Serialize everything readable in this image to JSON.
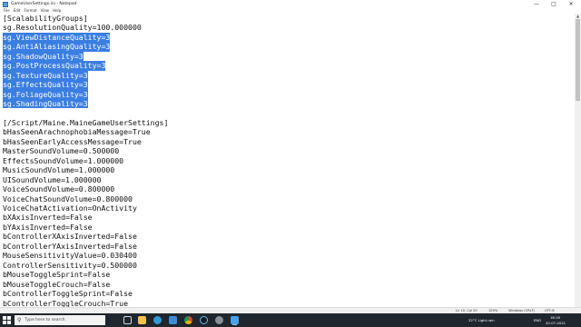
{
  "window": {
    "title": "GameUserSettings.ini - Notepad",
    "controls": [
      "—",
      "□",
      "✕"
    ]
  },
  "menu": [
    "File",
    "Edit",
    "Format",
    "View",
    "Help"
  ],
  "editor": {
    "lines": [
      {
        "text": "[ScalabilityGroups]",
        "selected": false
      },
      {
        "text": "sg.ResolutionQuality=100.000000",
        "selected": false
      },
      {
        "text": "sg.ViewDistanceQuality=3",
        "selected": true
      },
      {
        "text": "sg.AntiAliasingQuality=3",
        "selected": true
      },
      {
        "text": "sg.ShadowQuality=3",
        "selected": true
      },
      {
        "text": "sg.PostProcessQuality=3",
        "selected": true
      },
      {
        "text": "sg.TextureQuality=3",
        "selected": true
      },
      {
        "text": "sg.EffectsQuality=3",
        "selected": true
      },
      {
        "text": "sg.FoliageQuality=3",
        "selected": true
      },
      {
        "text": "sg.ShadingQuality=3",
        "selected": true
      },
      {
        "text": "",
        "selected": false
      },
      {
        "text": "[/Script/Maine.MaineGameUserSettings]",
        "selected": false
      },
      {
        "text": "bHasSeenArachnophobiaMessage=True",
        "selected": false
      },
      {
        "text": "bHasSeenEarlyAccessMessage=True",
        "selected": false
      },
      {
        "text": "MasterSoundVolume=0.500000",
        "selected": false
      },
      {
        "text": "EffectsSoundVolume=1.000000",
        "selected": false
      },
      {
        "text": "MusicSoundVolume=1.000000",
        "selected": false
      },
      {
        "text": "UISoundVolume=1.000000",
        "selected": false
      },
      {
        "text": "VoiceSoundVolume=0.800000",
        "selected": false
      },
      {
        "text": "VoiceChatSoundVolume=0.800000",
        "selected": false
      },
      {
        "text": "VoiceChatActivation=OnActivity",
        "selected": false
      },
      {
        "text": "bXAxisInverted=False",
        "selected": false
      },
      {
        "text": "bYAxisInverted=False",
        "selected": false
      },
      {
        "text": "bControllerXAxisInverted=False",
        "selected": false
      },
      {
        "text": "bControllerYAxisInverted=False",
        "selected": false
      },
      {
        "text": "MouseSensitivityValue=0.030400",
        "selected": false
      },
      {
        "text": "ControllerSensitivity=0.500000",
        "selected": false
      },
      {
        "text": "bMouseToggleSprint=False",
        "selected": false
      },
      {
        "text": "bMouseToggleCrouch=False",
        "selected": false
      },
      {
        "text": "bControllerToggleSprint=False",
        "selected": false
      },
      {
        "text": "bControllerToggleCrouch=True",
        "selected": false
      }
    ]
  },
  "statusbar": {
    "position": "Ln 10, Col 20",
    "zoom": "100%",
    "line_ending": "Windows (CRLF)",
    "encoding": "UTF-8"
  },
  "taskbar": {
    "search_placeholder": "Type here to search",
    "weather": "32°C  Light rain",
    "language": "ENG",
    "time": "18:16",
    "date": "20-07-2021",
    "icons": [
      "task-view-icon",
      "explorer-icon",
      "edge-icon",
      "store-icon",
      "chrome-icon",
      "steam-icon",
      "settings-icon",
      "notepad-icon"
    ]
  },
  "colors": {
    "selection": "#3b7ee2",
    "taskbar": "#20262e"
  }
}
